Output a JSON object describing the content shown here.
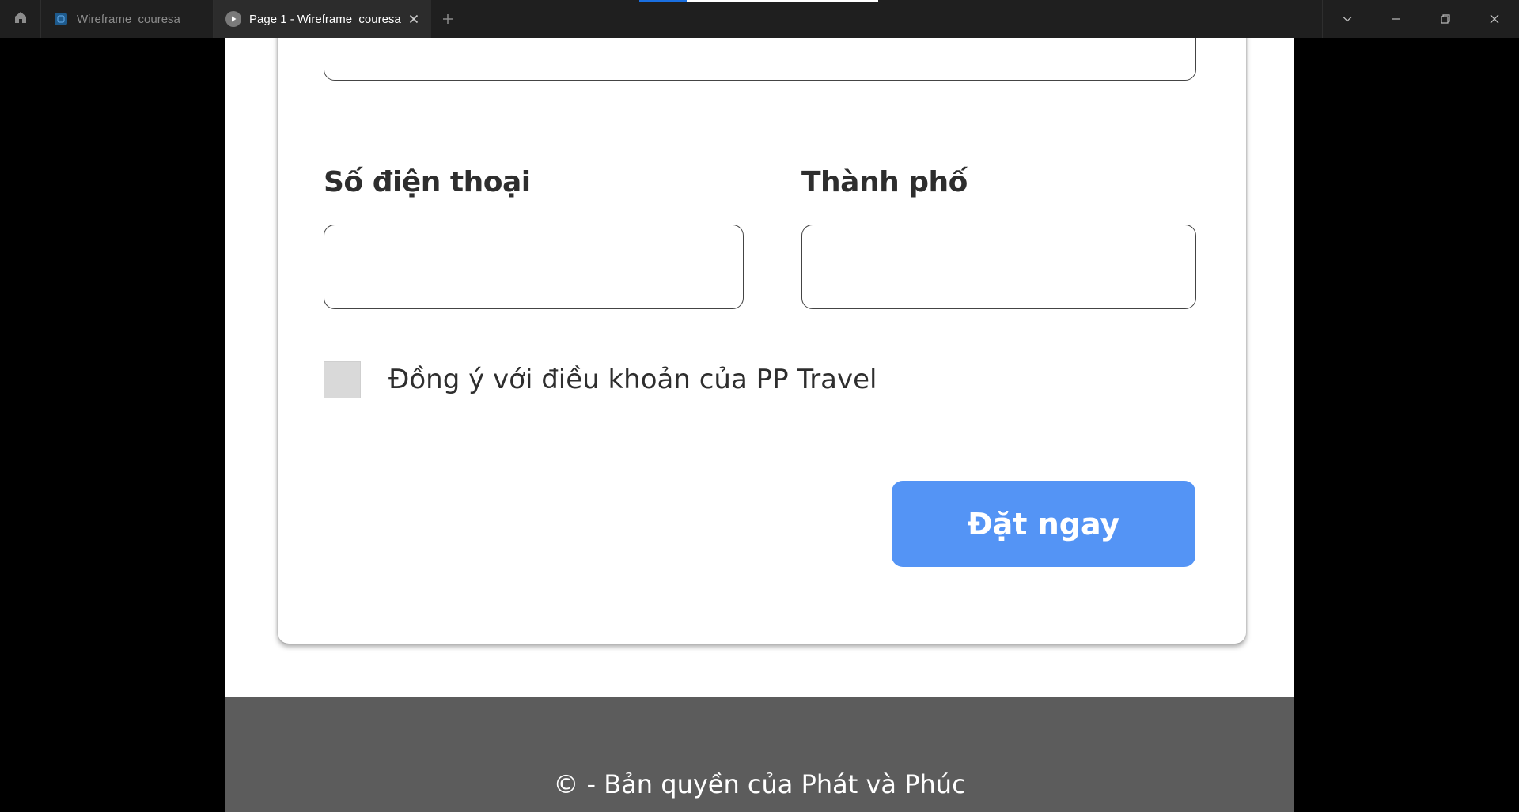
{
  "window": {
    "tabs": [
      {
        "label": "Wireframe_couresa",
        "active": false
      },
      {
        "label": "Page 1 - Wireframe_couresa",
        "active": true
      }
    ]
  },
  "form": {
    "phone_label": "Số điện thoại",
    "phone_value": "",
    "city_label": "Thành phố",
    "city_value": "",
    "consent_label": "Đồng ý với điều khoản của PP Travel",
    "consent_checked": false,
    "submit_label": "Đặt ngay"
  },
  "footer": {
    "text": "© - Bản quyền của Phát và Phúc"
  },
  "colors": {
    "accent": "#5494f5",
    "footer_bg": "#5c5c5c",
    "titlebar_bg": "#1f1f1f",
    "checkbox_bg": "#d9d9d9"
  }
}
